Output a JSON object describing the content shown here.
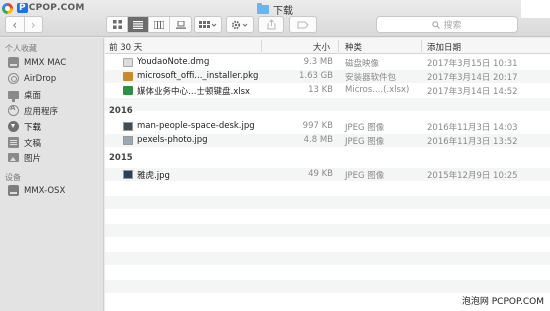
{
  "site_logo": {
    "pre": "",
    "hl1": "P",
    "mid": "CPOP",
    "suffix": ".COM"
  },
  "window": {
    "title": "下载"
  },
  "toolbar": {
    "back": "‹",
    "forward": "›",
    "search_placeholder": "搜索"
  },
  "sidebar": {
    "favorites_heading": "个人收藏",
    "items": [
      {
        "label": "MMX MAC",
        "icon": "hard-disk-icon"
      },
      {
        "label": "AirDrop",
        "icon": "airdrop-icon"
      },
      {
        "label": "桌面",
        "icon": "desktop-icon"
      },
      {
        "label": "应用程序",
        "icon": "applications-icon"
      },
      {
        "label": "下载",
        "icon": "downloads-icon"
      },
      {
        "label": "文稿",
        "icon": "documents-icon"
      },
      {
        "label": "图片",
        "icon": "pictures-icon"
      }
    ],
    "devices_heading": "设备",
    "devices": [
      {
        "label": "MMX-OSX",
        "icon": "computer-icon"
      }
    ]
  },
  "columns": {
    "name": "前 30 天",
    "size": "大小",
    "kind": "种类",
    "date": "添加日期"
  },
  "groups": [
    {
      "label": "",
      "files": [
        {
          "name": "YoudaoNote.dmg",
          "size": "9.3 MB",
          "kind": "磁盘映像",
          "date": "2017年3月15日 10:31"
        },
        {
          "name": "microsoft_offi..._installer.pkg",
          "size": "1.63 GB",
          "kind": "安装器软件包",
          "date": "2017年3月14日 20:17"
        },
        {
          "name": "媒体业务中心…士顿键盘.xlsx",
          "size": "13 KB",
          "kind": "Micros....(.xlsx)",
          "date": "2017年3月14日 14:52"
        }
      ]
    },
    {
      "label": "2016",
      "files": [
        {
          "name": "man-people-space-desk.jpg",
          "size": "997 KB",
          "kind": "JPEG 图像",
          "date": "2016年11月3日 14:03"
        },
        {
          "name": "pexels-photo.jpg",
          "size": "4.8 MB",
          "kind": "JPEG 图像",
          "date": "2016年11月3日 13:52"
        }
      ]
    },
    {
      "label": "2015",
      "files": [
        {
          "name": "雅虎.jpg",
          "size": "49 KB",
          "kind": "JPEG 图像",
          "date": "2015年12月9日 10:25"
        }
      ]
    }
  ],
  "watermark": "泡泡网 PCPOP.COM"
}
